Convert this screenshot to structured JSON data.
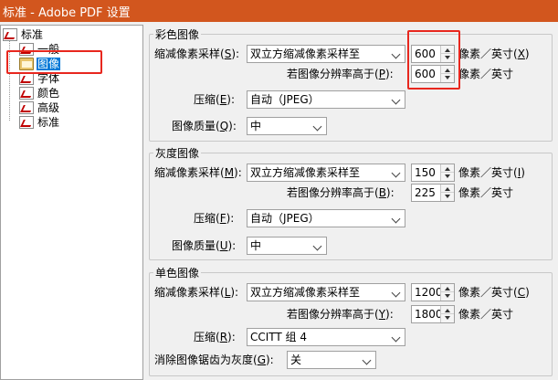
{
  "window": {
    "title": "标准 - Adobe PDF 设置"
  },
  "tree": {
    "root": "标准",
    "items": [
      "一般",
      "图像",
      "字体",
      "颜色",
      "高级",
      "标准"
    ],
    "selected_index": 1
  },
  "color_images": {
    "title": "彩色图像",
    "downsample_label": "缩减像素采样(",
    "downsample_key": "S",
    "downsample_value": "双立方缩减像素采样至",
    "downsample_res": "600",
    "unit": "像素／英寸(",
    "unit_key_1": "X",
    "above_label": "若图像分辨率高于(",
    "above_key": "P",
    "above_res": "600",
    "unit_plain": "像素／英寸",
    "compress_label": "压缩(",
    "compress_key": "E",
    "compress_value": "自动（JPEG）",
    "quality_label": "图像质量(",
    "quality_key": "Q",
    "quality_value": "中"
  },
  "gray_images": {
    "title": "灰度图像",
    "downsample_label": "缩减像素采样(",
    "downsample_key": "M",
    "downsample_value": "双立方缩减像素采样至",
    "downsample_res": "150",
    "unit": "像素／英寸(",
    "unit_key": "I",
    "above_label": "若图像分辨率高于(",
    "above_key": "B",
    "above_res": "225",
    "unit_plain": "像素／英寸",
    "compress_label": "压缩(",
    "compress_key": "F",
    "compress_value": "自动（JPEG）",
    "quality_label": "图像质量(",
    "quality_key": "U",
    "quality_value": "中"
  },
  "mono_images": {
    "title": "单色图像",
    "downsample_label": "缩减像素采样(",
    "downsample_key": "L",
    "downsample_value": "双立方缩减像素采样至",
    "downsample_res": "1200",
    "unit": "像素／英寸(",
    "unit_key": "C",
    "above_label": "若图像分辨率高于(",
    "above_key": "Y",
    "above_res": "1800",
    "unit_plain": "像素／英寸",
    "compress_label": "压缩(",
    "compress_key": "R",
    "compress_value": "CCITT 组 4",
    "antialias_label": "消除图像锯齿为灰度(",
    "antialias_key": "G",
    "antialias_value": "关"
  },
  "colors": {
    "titlebar": "#d2561e",
    "highlight": "#e8271e",
    "selection": "#0078d7"
  }
}
